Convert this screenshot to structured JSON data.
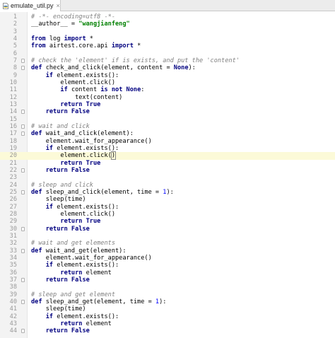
{
  "tab": {
    "label": "emulate_util.py",
    "close": "×"
  },
  "current_line": 20,
  "lines": [
    {
      "n": "1",
      "t": [
        [
          "cm",
          "# -*- encoding=utf8 -*-"
        ]
      ]
    },
    {
      "n": "2",
      "t": [
        [
          "",
          "__author__ = "
        ],
        [
          "str",
          "\"wangjianfeng\""
        ]
      ]
    },
    {
      "n": "3",
      "t": []
    },
    {
      "n": "4",
      "t": [
        [
          "kw",
          "from"
        ],
        [
          "",
          " log "
        ],
        [
          "kw",
          "import"
        ],
        [
          "",
          " *"
        ]
      ]
    },
    {
      "n": "5",
      "t": [
        [
          "kw",
          "from"
        ],
        [
          "",
          " airtest.core.api "
        ],
        [
          "kw",
          "import"
        ],
        [
          "",
          " *"
        ]
      ]
    },
    {
      "n": "6",
      "t": []
    },
    {
      "n": "7",
      "t": [
        [
          "cm",
          "# check the 'element' if is exists, and put the 'content'"
        ]
      ]
    },
    {
      "n": "8",
      "t": [
        [
          "kw",
          "def"
        ],
        [
          "",
          " check_and_click(element, content = "
        ],
        [
          "kw",
          "None"
        ],
        [
          "",
          "):"
        ]
      ]
    },
    {
      "n": "9",
      "t": [
        [
          "",
          "    "
        ],
        [
          "kw",
          "if"
        ],
        [
          "",
          " element.exists():"
        ]
      ]
    },
    {
      "n": "10",
      "t": [
        [
          "",
          "        element.click()"
        ]
      ]
    },
    {
      "n": "11",
      "t": [
        [
          "",
          "        "
        ],
        [
          "kw",
          "if"
        ],
        [
          "",
          " content "
        ],
        [
          "kw",
          "is not None"
        ],
        [
          "",
          ":"
        ]
      ]
    },
    {
      "n": "12",
      "t": [
        [
          "",
          "            text(content)"
        ]
      ]
    },
    {
      "n": "13",
      "t": [
        [
          "",
          "        "
        ],
        [
          "kw",
          "return True"
        ]
      ]
    },
    {
      "n": "14",
      "t": [
        [
          "",
          "    "
        ],
        [
          "kw",
          "return False"
        ]
      ]
    },
    {
      "n": "15",
      "t": []
    },
    {
      "n": "16",
      "t": [
        [
          "cm",
          "# wait and click"
        ]
      ]
    },
    {
      "n": "17",
      "t": [
        [
          "kw",
          "def"
        ],
        [
          "",
          " wait_and_click(element):"
        ]
      ]
    },
    {
      "n": "18",
      "t": [
        [
          "",
          "    element.wait_for_appearance()"
        ]
      ]
    },
    {
      "n": "19",
      "t": [
        [
          "",
          "    "
        ],
        [
          "kw",
          "if"
        ],
        [
          "",
          " element.exists():"
        ]
      ]
    },
    {
      "n": "20",
      "t": [
        [
          "",
          "        element.click("
        ],
        [
          "caret",
          ")"
        ]
      ]
    },
    {
      "n": "21",
      "t": [
        [
          "",
          "        "
        ],
        [
          "kw",
          "return True"
        ]
      ]
    },
    {
      "n": "22",
      "t": [
        [
          "",
          "    "
        ],
        [
          "kw",
          "return False"
        ]
      ]
    },
    {
      "n": "23",
      "t": []
    },
    {
      "n": "24",
      "t": [
        [
          "cm",
          "# sleep and click"
        ]
      ]
    },
    {
      "n": "25",
      "t": [
        [
          "kw",
          "def"
        ],
        [
          "",
          " sleep_and_click(element, time = "
        ],
        [
          "num",
          "1"
        ],
        [
          "",
          "):"
        ]
      ]
    },
    {
      "n": "26",
      "t": [
        [
          "",
          "    sleep(time)"
        ]
      ]
    },
    {
      "n": "27",
      "t": [
        [
          "",
          "    "
        ],
        [
          "kw",
          "if"
        ],
        [
          "",
          " element.exists():"
        ]
      ]
    },
    {
      "n": "28",
      "t": [
        [
          "",
          "        element.click()"
        ]
      ]
    },
    {
      "n": "29",
      "t": [
        [
          "",
          "        "
        ],
        [
          "kw",
          "return True"
        ]
      ]
    },
    {
      "n": "30",
      "t": [
        [
          "",
          "    "
        ],
        [
          "kw",
          "return False"
        ]
      ]
    },
    {
      "n": "31",
      "t": []
    },
    {
      "n": "32",
      "t": [
        [
          "cm",
          "# wait and get elements"
        ]
      ]
    },
    {
      "n": "33",
      "t": [
        [
          "kw",
          "def"
        ],
        [
          "",
          " wait_and_get(element):"
        ]
      ]
    },
    {
      "n": "34",
      "t": [
        [
          "",
          "    element.wait_for_appearance()"
        ]
      ]
    },
    {
      "n": "35",
      "t": [
        [
          "",
          "    "
        ],
        [
          "kw",
          "if"
        ],
        [
          "",
          " element.exists():"
        ]
      ]
    },
    {
      "n": "36",
      "t": [
        [
          "",
          "        "
        ],
        [
          "kw",
          "return"
        ],
        [
          "",
          " element"
        ]
      ]
    },
    {
      "n": "37",
      "t": [
        [
          "",
          "    "
        ],
        [
          "kw",
          "return False"
        ]
      ]
    },
    {
      "n": "38",
      "t": []
    },
    {
      "n": "39",
      "t": [
        [
          "cm",
          "# sleep and get element"
        ]
      ]
    },
    {
      "n": "40",
      "t": [
        [
          "kw",
          "def"
        ],
        [
          "",
          " sleep_and_get(element, time = "
        ],
        [
          "num",
          "1"
        ],
        [
          "",
          "):"
        ]
      ]
    },
    {
      "n": "41",
      "t": [
        [
          "",
          "    sleep(time)"
        ]
      ]
    },
    {
      "n": "42",
      "t": [
        [
          "",
          "    "
        ],
        [
          "kw",
          "if"
        ],
        [
          "",
          " element.exists():"
        ]
      ]
    },
    {
      "n": "43",
      "t": [
        [
          "",
          "        "
        ],
        [
          "kw",
          "return"
        ],
        [
          "",
          " element"
        ]
      ]
    },
    {
      "n": "44",
      "t": [
        [
          "",
          "    "
        ],
        [
          "kw",
          "return False"
        ]
      ]
    }
  ],
  "folds": [
    7,
    8,
    14,
    16,
    17,
    22,
    25,
    30,
    33,
    37,
    40,
    44
  ]
}
